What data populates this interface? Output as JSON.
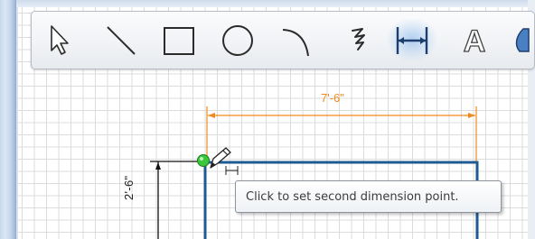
{
  "toolbar": {
    "tools": [
      {
        "id": "select",
        "icon": "arrow-cursor-icon",
        "active": false
      },
      {
        "id": "line",
        "icon": "line-icon",
        "active": false
      },
      {
        "id": "rectangle",
        "icon": "rectangle-icon",
        "active": false
      },
      {
        "id": "circle",
        "icon": "circle-icon",
        "active": false
      },
      {
        "id": "arc",
        "icon": "arc-icon",
        "active": false
      },
      {
        "id": "freehand",
        "icon": "freehand-icon",
        "active": false
      },
      {
        "id": "dimension",
        "icon": "dimension-icon",
        "active": true
      },
      {
        "id": "text",
        "icon": "text-icon",
        "text_glyph": "A",
        "active": false
      },
      {
        "id": "fill",
        "icon": "fill-icon",
        "active": false
      }
    ]
  },
  "drawing": {
    "dimension_horizontal": "7'-6\"",
    "dimension_vertical": "2'-6\""
  },
  "tooltip": {
    "text": "Click to set second dimension point."
  },
  "colors": {
    "dimension_line": "#f08a1c",
    "wall": "#1f5a93",
    "snap_point": "#3cc83c",
    "grid": "#dcdcdc",
    "tool_active_glow": "#7aaeea"
  }
}
